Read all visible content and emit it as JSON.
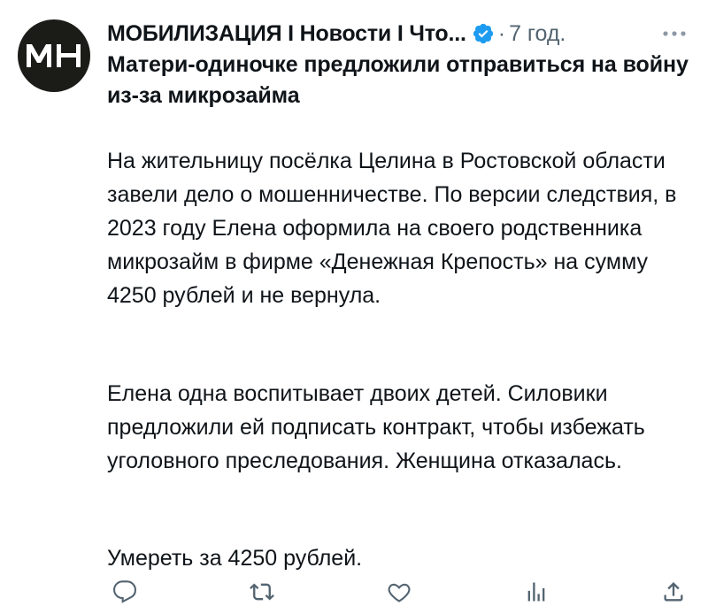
{
  "author": {
    "name": "МОБИЛИЗАЦИЯ I Новости I Что...",
    "avatar_text": "МН",
    "verified_icon": "verified-badge-icon",
    "time": "7 год."
  },
  "post": {
    "headline": "Матери-одиночке предложили отправиться на войну из-за микрозайма",
    "paragraphs": [
      "На жительницу посёлка Целина в Ростовской области завели дело о мошенничестве. По версии следствия, в 2023 году Елена оформила на своего родственника микрозайм в фирме «Денежная Крепость» на сумму 4250 рублей и не вернула.",
      "Елена одна воспитывает двоих детей. Силовики предложили ей подписать контракт, чтобы избежать уголовного преследования. Женщина отказалась.",
      "Умереть за 4250 рублей."
    ]
  },
  "icons": {
    "more": "more-options-icon",
    "reply": "reply-icon",
    "repost": "repost-icon",
    "like": "like-icon",
    "views": "views-icon",
    "share": "share-icon"
  },
  "colors": {
    "text": "#0f1419",
    "muted": "#536471",
    "verified": "#1d9bf0",
    "avatar_bg": "#1b1b18"
  }
}
